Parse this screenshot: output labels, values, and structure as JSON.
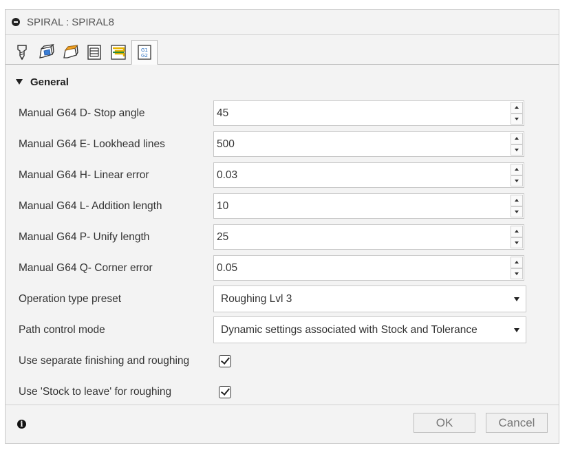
{
  "dialog": {
    "title": "SPIRAL : SPIRAL8",
    "tabs": [
      {
        "icon": "tool-icon"
      },
      {
        "icon": "geometry-icon"
      },
      {
        "icon": "heights-icon"
      },
      {
        "icon": "passes-icon"
      },
      {
        "icon": "linking-icon"
      },
      {
        "icon": "gcode-icon",
        "active": true
      }
    ],
    "section": {
      "title": "General"
    },
    "fields": [
      {
        "label": "Manual G64 D- Stop angle",
        "value": "45"
      },
      {
        "label": "Manual G64 E- Lookhead lines",
        "value": "500"
      },
      {
        "label": "Manual G64 H- Linear error",
        "value": "0.03"
      },
      {
        "label": "Manual G64 L- Addition length",
        "value": "10"
      },
      {
        "label": "Manual G64 P- Unify length",
        "value": "25"
      },
      {
        "label": "Manual G64 Q- Corner error",
        "value": "0.05"
      }
    ],
    "selects": [
      {
        "label": "Operation type preset",
        "value": "Roughing Lvl 3"
      },
      {
        "label": "Path control mode",
        "value": "Dynamic settings associated with Stock and Tolerance"
      }
    ],
    "checkboxes": [
      {
        "label": "Use separate finishing and roughing",
        "checked": true
      },
      {
        "label": "Use 'Stock to leave' for roughing",
        "checked": true
      }
    ],
    "footer": {
      "ok_label": "OK",
      "cancel_label": "Cancel"
    }
  }
}
